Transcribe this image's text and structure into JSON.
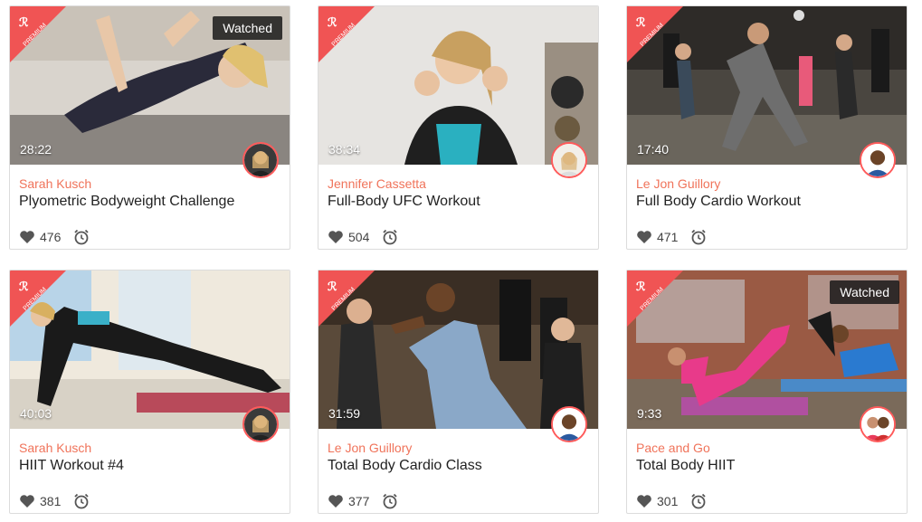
{
  "colors": {
    "accent": "#f0735a",
    "premium": "#f05454",
    "avatar_ring": "#ff5a5a"
  },
  "badge": {
    "premium_text": "PREMIUM",
    "logo_icon": "logo-icon"
  },
  "workouts": [
    {
      "trainer": "Sarah Kusch",
      "title": "Plyometric Bodyweight Challenge",
      "duration": "28:22",
      "likes": "476",
      "watched": "Watched"
    },
    {
      "trainer": "Jennifer Cassetta",
      "title": "Full-Body UFC Workout",
      "duration": "38:34",
      "likes": "504"
    },
    {
      "trainer": "Le Jon Guillory",
      "title": "Full Body Cardio Workout",
      "duration": "17:40",
      "likes": "471"
    },
    {
      "trainer": "Sarah Kusch",
      "title": "HIIT Workout #4",
      "duration": "40:03",
      "likes": "381"
    },
    {
      "trainer": "Le Jon Guillory",
      "title": "Total Body Cardio Class",
      "duration": "31:59",
      "likes": "377"
    },
    {
      "trainer": "Pace and Go",
      "title": "Total Body HIIT",
      "duration": "9:33",
      "likes": "301",
      "watched": "Watched"
    }
  ]
}
